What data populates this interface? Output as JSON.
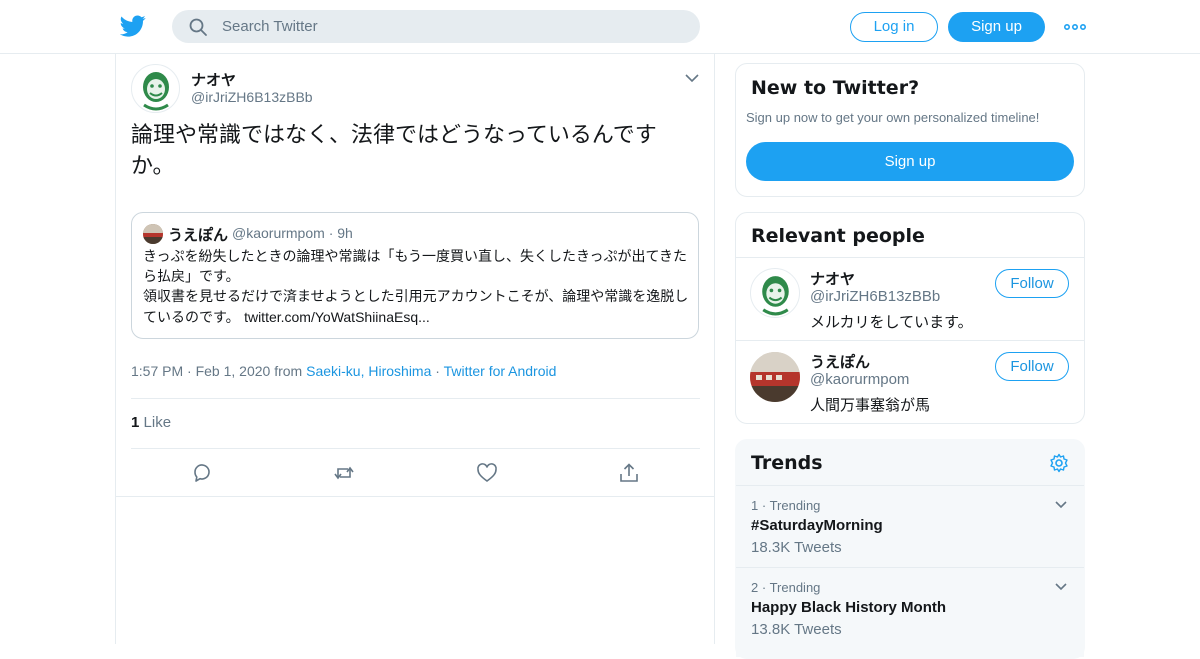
{
  "header": {
    "search_placeholder": "Search Twitter",
    "login_label": "Log in",
    "signup_label": "Sign up"
  },
  "tweet": {
    "author_name": "ナオヤ",
    "author_handle": "@irJriZH6B13zBBb",
    "text": "論理や常識ではなく、法律ではどうなっているんですか。",
    "quote": {
      "author_name": "うえぽん",
      "author_handle": "@kaorurmpom",
      "age": "9h",
      "text_line1": "きっぷを紛失したときの論理や常識は「もう一度買い直し、失くしたきっぷが出てきたら払戻」です。",
      "text_line2": "領収書を見せるだけで済ませようとした引用元アカウントこそが、論理や常識を逸脱しているのです。",
      "link": "twitter.com/YoWatShiinaEsq..."
    },
    "time": "1:57 PM",
    "date": "Feb 1, 2020",
    "from_label": "from",
    "location": "Saeki-ku, Hiroshima",
    "client": "Twitter for Android",
    "like_count": "1",
    "like_label": "Like"
  },
  "sidebar": {
    "new_to_twitter": {
      "title": "New to Twitter?",
      "subtitle": "Sign up now to get your own personalized timeline!",
      "button": "Sign up"
    },
    "relevant_people": {
      "title": "Relevant people",
      "people": [
        {
          "name": "ナオヤ",
          "handle": "@irJriZH6B13zBBb",
          "bio": "メルカリをしています。",
          "follow": "Follow"
        },
        {
          "name": "うえぽん",
          "handle": "@kaorurmpom",
          "bio": "人間万事塞翁が馬",
          "follow": "Follow"
        }
      ]
    },
    "trends": {
      "title": "Trends",
      "items": [
        {
          "rank": "1",
          "label": "Trending",
          "title": "#SaturdayMorning",
          "count": "18.3K Tweets"
        },
        {
          "rank": "2",
          "label": "Trending",
          "title": "Happy Black History Month",
          "count": "13.8K Tweets"
        }
      ]
    }
  },
  "colors": {
    "accent": "#1da1f2",
    "link": "#1b95e0",
    "muted": "#657786",
    "border": "#e6ecf0"
  }
}
